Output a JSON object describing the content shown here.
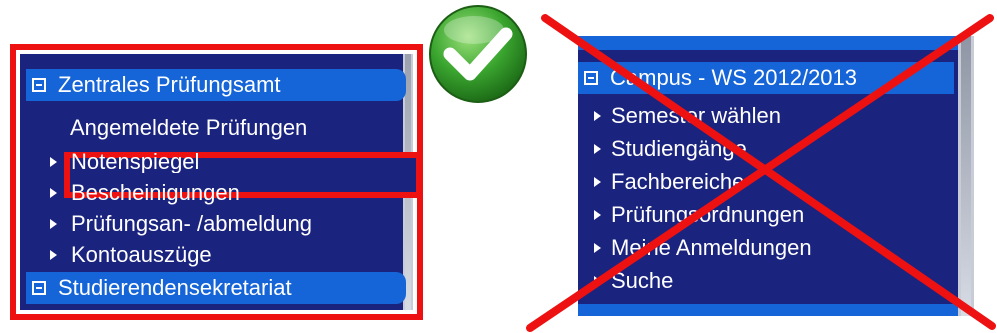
{
  "left_panel": {
    "section_1": "Zentrales Prüfungsamt",
    "items": [
      "Angemeldete Prüfungen",
      "Notenspiegel",
      "Bescheinigungen",
      "Prüfungsan- /abmeldung",
      "Kontoauszüge"
    ],
    "section_2": "Studierendensekretariat"
  },
  "right_panel": {
    "section": "Campus - WS 2012/2013",
    "items": [
      "Semester wählen",
      "Studiengänge",
      "Fachbereiche",
      "Prüfungsordnungen",
      "Meine Anmeldungen",
      "Suche"
    ]
  },
  "icons": {
    "correct": "checkmark-icon",
    "wrong": "cross-mark"
  },
  "colors": {
    "menu_bg": "#1a237e",
    "header_bg": "#1565d8",
    "annotation_red": "#ee1111",
    "check_green": "#2e9e2a"
  }
}
